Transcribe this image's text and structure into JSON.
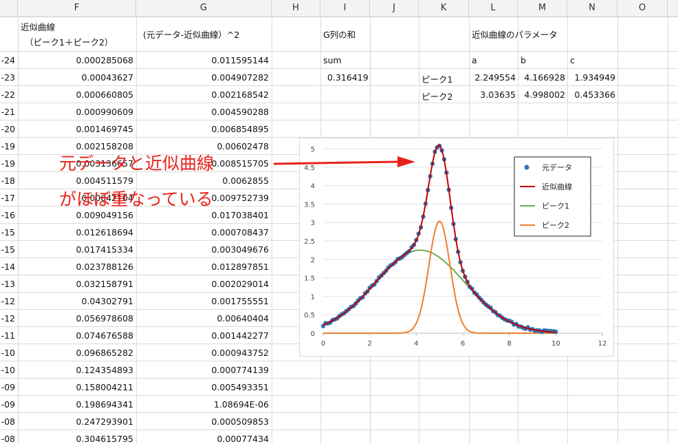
{
  "columns": [
    "F",
    "G",
    "H",
    "I",
    "J",
    "K",
    "L",
    "M",
    "N",
    "O"
  ],
  "header_f_line1": "近似曲線",
  "header_f_line2": "（ピーク1＋ピーク2）",
  "header_g": "(元データ-近似曲線）^2",
  "header_i": "G列の和",
  "header_l": "近似曲線のパラメータ",
  "sum_label": "sum",
  "sum_value": "0.316419",
  "param_headers": [
    "a",
    "b",
    "c"
  ],
  "peak1": {
    "label": "ピーク1",
    "a": "2.249554",
    "b": "4.166928",
    "c": "1.934949"
  },
  "peak2": {
    "label": "ピーク2",
    "a": "3.03635",
    "b": "4.998002",
    "c": "0.453366"
  },
  "rows": [
    {
      "e": "-24",
      "f": "0.000285068",
      "g": "0.011595144"
    },
    {
      "e": "-23",
      "f": "0.00043627",
      "g": "0.004907282"
    },
    {
      "e": "-22",
      "f": "0.000660805",
      "g": "0.002168542"
    },
    {
      "e": "-21",
      "f": "0.000990609",
      "g": "0.004590288"
    },
    {
      "e": "-20",
      "f": "0.001469745",
      "g": "0.006854895"
    },
    {
      "e": "-19",
      "f": "0.002158208",
      "g": "0.00602478"
    },
    {
      "e": "-19",
      "f": "0.003136657",
      "g": "0.008515705"
    },
    {
      "e": "-18",
      "f": "0.004511579",
      "g": "0.0062855"
    },
    {
      "e": "-17",
      "f": "0.00642104",
      "g": "0.009752739"
    },
    {
      "e": "-16",
      "f": "0.009049156",
      "g": "0.017038401"
    },
    {
      "e": "-15",
      "f": "0.012618694",
      "g": "0.000708437"
    },
    {
      "e": "-15",
      "f": "0.017415334",
      "g": "0.003049676"
    },
    {
      "e": "-14",
      "f": "0.023788126",
      "g": "0.012897851"
    },
    {
      "e": "-13",
      "f": "0.032158791",
      "g": "0.002029014"
    },
    {
      "e": "-12",
      "f": "0.04302791",
      "g": "0.001755551"
    },
    {
      "e": "-12",
      "f": "0.056978608",
      "g": "0.00640404"
    },
    {
      "e": "-11",
      "f": "0.074676588",
      "g": "0.001442277"
    },
    {
      "e": "-10",
      "f": "0.096865282",
      "g": "0.000943752"
    },
    {
      "e": "-10",
      "f": "0.124354893",
      "g": "0.000774139"
    },
    {
      "e": "-09",
      "f": "0.158004211",
      "g": "0.005493351"
    },
    {
      "e": "-09",
      "f": "0.198694341",
      "g": "1.08694E-06"
    },
    {
      "e": "-08",
      "f": "0.247293901",
      "g": "0.000509853"
    },
    {
      "e": "-08",
      "f": "0.304615795",
      "g": "0.00077434"
    }
  ],
  "annotation": {
    "line1": "元データと近似曲線",
    "line2": "がほぼ重なっている",
    "color": "#e8201a"
  },
  "chart_data": {
    "type": "scatter",
    "xlim": [
      0,
      12
    ],
    "ylim": [
      0,
      5
    ],
    "xticks": [
      0,
      2,
      4,
      6,
      8,
      10,
      12
    ],
    "yticks": [
      0,
      0.5,
      1,
      1.5,
      2,
      2.5,
      3,
      3.5,
      4,
      4.5,
      5
    ],
    "legend_position": "top-right",
    "series": [
      {
        "name": "元データ",
        "kind": "points",
        "color": "#2e75b6",
        "x_from": 0,
        "x_to": 10,
        "x_step": 0.1
      },
      {
        "name": "近似曲線",
        "kind": "line",
        "color": "#c00000"
      },
      {
        "name": "ピーク1",
        "kind": "line",
        "color": "#70ad47"
      },
      {
        "name": "ピーク2",
        "kind": "line",
        "color": "#ed7d31"
      }
    ],
    "peak1": {
      "a": 2.249554,
      "b": 4.166928,
      "c": 1.934949
    },
    "peak2": {
      "a": 3.03635,
      "b": 4.998002,
      "c": 0.453366
    },
    "noise_amplitude": 0.06
  }
}
